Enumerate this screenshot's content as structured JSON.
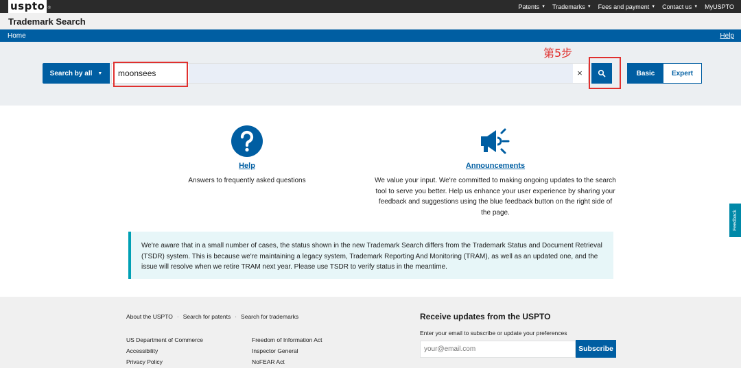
{
  "topbar": {
    "logo_text": "uspto",
    "logo_reg": "®",
    "nav": [
      "Patents",
      "Trademarks",
      "Fees and payment",
      "Contact us",
      "MyUSPTO"
    ]
  },
  "header": {
    "title": "Trademark Search"
  },
  "breadcrumb": {
    "home": "Home",
    "help": "Help"
  },
  "annotation": {
    "step_label": "第5步",
    "color": "#e0302e"
  },
  "search": {
    "type_label": "Search by all",
    "value": "moonsees",
    "clear_symbol": "×",
    "mode_basic": "Basic",
    "mode_expert": "Expert"
  },
  "cards": {
    "help": {
      "link": "Help",
      "text": "Answers to frequently asked questions"
    },
    "announcements": {
      "link": "Announcements",
      "text": "We value your input. We're committed to making ongoing updates to the search tool to serve you better. Help us enhance your user experience by sharing your feedback and suggestions using the blue feedback button on the right side of the page."
    }
  },
  "notice": {
    "text": "We're aware that in a small number of cases, the status shown in the new Trademark Search differs from the Trademark Status and Document Retrieval (TSDR) system. This is because we're maintaining a legacy system, Trademark Reporting And Monitoring (TRAM), as well as an updated one, and the issue will resolve when we retire TRAM next year. Please use TSDR to verify status in the meantime."
  },
  "footer": {
    "top_links": [
      "About the USPTO",
      "Search for patents",
      "Search for trademarks"
    ],
    "col1": [
      "US Department of Commerce",
      "Accessibility",
      "Privacy Policy"
    ],
    "col2": [
      "Freedom of Information Act",
      "Inspector General",
      "NoFEAR Act"
    ],
    "subscribe_title": "Receive updates from the USPTO",
    "subscribe_desc": "Enter your email to subscribe or update your preferences",
    "email_placeholder": "your@email.com",
    "subscribe_button": "Subscribe"
  },
  "feedback": {
    "label": "Feedback"
  },
  "colors": {
    "primary": "#005ea2",
    "topbar": "#2b2b2b",
    "notice_border": "#00a0b4"
  }
}
